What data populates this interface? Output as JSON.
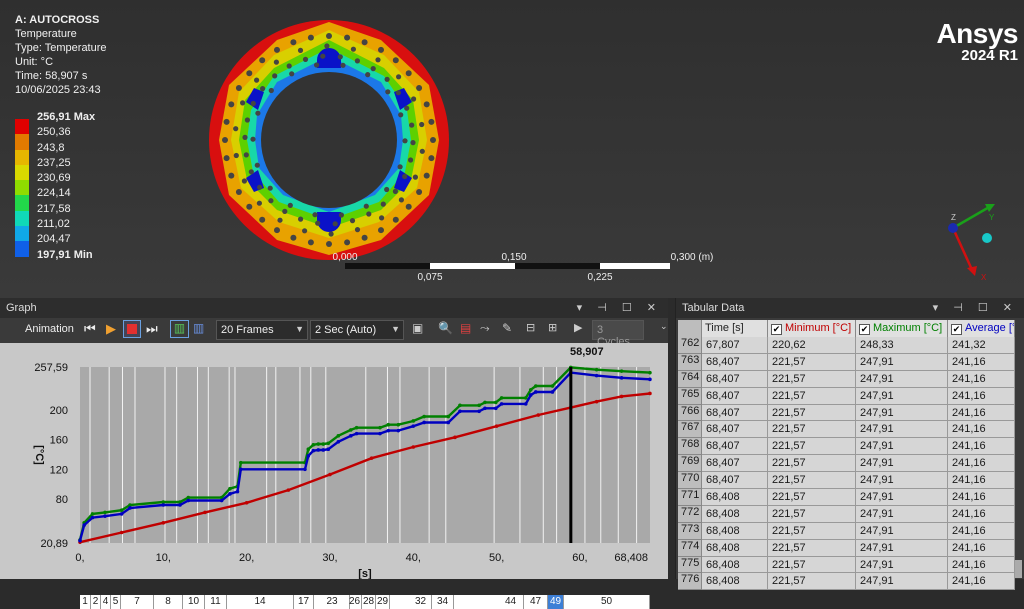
{
  "viewport": {
    "info": {
      "title": "A: AUTOCROSS",
      "result": "Temperature",
      "type": "Type: Temperature",
      "unit": "Unit: °C",
      "time": "Time: 58,907 s",
      "date": "10/06/2025 23:43"
    },
    "legend": [
      {
        "label": "256,91 Max",
        "color": "#e00000",
        "bold": true
      },
      {
        "label": "250,36",
        "color": "#e27a00"
      },
      {
        "label": "243,8",
        "color": "#e6b600"
      },
      {
        "label": "237,25",
        "color": "#d9d900"
      },
      {
        "label": "230,69",
        "color": "#8fdc00"
      },
      {
        "label": "224,14",
        "color": "#22d84a"
      },
      {
        "label": "217,58",
        "color": "#10d8b8"
      },
      {
        "label": "211,02",
        "color": "#10a8e8"
      },
      {
        "label": "204,47",
        "color": "#1060e8"
      },
      {
        "label": "197,91 Min",
        "color": "#0a0ad0",
        "bold": true
      }
    ],
    "logo": {
      "brand": "Ansys",
      "version": "2024 R1"
    },
    "scale": {
      "top": [
        "0,000",
        "0,150",
        "0,300 (m)"
      ],
      "bottom": [
        "0,075",
        "0,225"
      ]
    },
    "triad": {
      "x": "X",
      "y": "Y",
      "z": "Z"
    }
  },
  "graph_panel": {
    "title": "Graph",
    "header_controls": "▾ ⊣ ☐ ✕",
    "animation_label": "Animation",
    "frames_select": "20 Frames",
    "duration_select": "2 Sec (Auto)",
    "cycles_placeholder": "3 Cycles"
  },
  "tabular_panel": {
    "title": "Tabular Data",
    "header_controls": "▾ ⊣ ☐ ✕",
    "columns": [
      "Time [s]",
      "Minimum [°C]",
      "Maximum [°C]",
      "Average [°C]"
    ],
    "rows": [
      [
        "762",
        "67,807",
        "220,62",
        "248,33",
        "241,32"
      ],
      [
        "763",
        "68,407",
        "221,57",
        "247,91",
        "241,16"
      ],
      [
        "764",
        "68,407",
        "221,57",
        "247,91",
        "241,16"
      ],
      [
        "765",
        "68,407",
        "221,57",
        "247,91",
        "241,16"
      ],
      [
        "766",
        "68,407",
        "221,57",
        "247,91",
        "241,16"
      ],
      [
        "767",
        "68,407",
        "221,57",
        "247,91",
        "241,16"
      ],
      [
        "768",
        "68,407",
        "221,57",
        "247,91",
        "241,16"
      ],
      [
        "769",
        "68,407",
        "221,57",
        "247,91",
        "241,16"
      ],
      [
        "770",
        "68,407",
        "221,57",
        "247,91",
        "241,16"
      ],
      [
        "771",
        "68,408",
        "221,57",
        "247,91",
        "241,16"
      ],
      [
        "772",
        "68,408",
        "221,57",
        "247,91",
        "241,16"
      ],
      [
        "773",
        "68,408",
        "221,57",
        "247,91",
        "241,16"
      ],
      [
        "774",
        "68,408",
        "221,57",
        "247,91",
        "241,16"
      ],
      [
        "775",
        "68,408",
        "221,57",
        "247,91",
        "241,16"
      ],
      [
        "776",
        "68,408",
        "221,57",
        "247,91",
        "241,16"
      ]
    ],
    "colors": {
      "minimum": "#c00000",
      "maximum": "#008000",
      "average": "#0000c0"
    }
  },
  "chart_data": {
    "type": "line",
    "xlabel": "[s]",
    "ylabel": "[°C]",
    "xlim": [
      0,
      68.408
    ],
    "ylim": [
      20.89,
      257.59
    ],
    "x_ticks": [
      "0,",
      "10,",
      "20,",
      "30,",
      "40,",
      "50,",
      "60,",
      "68,408"
    ],
    "x_tick_values": [
      0,
      10,
      20,
      30,
      40,
      50,
      60,
      68.408
    ],
    "y_ticks": [
      "20,89",
      "80",
      "120",
      "160",
      "200",
      "257,59"
    ],
    "y_tick_values": [
      20.89,
      80,
      120,
      160,
      200,
      257.59
    ],
    "cursor": {
      "x": 58.907,
      "label": "58,907"
    },
    "series": [
      {
        "name": "Minimum",
        "color": "#c00000",
        "x": [
          0,
          5,
          10,
          15,
          20,
          25,
          30,
          35,
          40,
          45,
          50,
          55,
          58.9,
          62,
          65,
          68.4
        ],
        "values": [
          22,
          35,
          48,
          62,
          75,
          92,
          113,
          135,
          150,
          163,
          178,
          193,
          203,
          211,
          218,
          222
        ]
      },
      {
        "name": "Maximum",
        "color": "#008000",
        "x": [
          0,
          0.5,
          1.5,
          3,
          5,
          6,
          10,
          12,
          13,
          17,
          18,
          18.9,
          19.3,
          27,
          27.4,
          28,
          28.6,
          29.2,
          29.8,
          31,
          32.5,
          33.2,
          36,
          37,
          38.2,
          40,
          41.3,
          44.2,
          45.6,
          47.9,
          48.6,
          49.9,
          50.6,
          53.5,
          54.1,
          54.7,
          56.7,
          58.9,
          62,
          65,
          68.4
        ],
        "values": [
          25,
          48,
          60,
          62,
          65,
          72,
          76,
          76,
          82,
          82,
          94,
          97,
          129,
          129,
          147,
          153,
          154,
          154,
          155,
          165,
          173,
          176,
          176,
          180,
          180,
          185,
          191,
          191,
          206,
          206,
          210,
          210,
          216,
          216,
          227,
          232,
          232,
          257,
          254,
          252,
          250
        ]
      },
      {
        "name": "Average",
        "color": "#0000c0",
        "x": [
          0,
          0.5,
          1.5,
          3,
          5,
          6,
          10,
          12,
          13,
          17,
          18,
          18.9,
          19.3,
          27,
          27.4,
          28,
          28.6,
          29.2,
          29.8,
          31,
          32.5,
          33.2,
          36,
          37,
          38.2,
          40,
          41.3,
          44.2,
          45.6,
          47.9,
          48.6,
          49.9,
          50.6,
          53.5,
          54.1,
          54.7,
          56.7,
          58.9,
          62,
          65,
          68.4
        ],
        "values": [
          24,
          45,
          55,
          57,
          60,
          68,
          72,
          72,
          78,
          78,
          87,
          90,
          120,
          120,
          138,
          145,
          146,
          146,
          147,
          157,
          165,
          168,
          168,
          172,
          172,
          178,
          183,
          183,
          198,
          198,
          202,
          202,
          208,
          208,
          220,
          224,
          224,
          250,
          246,
          243,
          241
        ]
      }
    ]
  },
  "frame_strip": [
    {
      "label": "1"
    },
    {
      "label": "2"
    },
    {
      "label": "4"
    },
    {
      "label": "5"
    },
    {
      "label": "7"
    },
    {
      "label": "8"
    },
    {
      "label": "10"
    },
    {
      "label": "11"
    },
    {
      "label": "14"
    },
    {
      "label": "17"
    },
    {
      "label": "23"
    },
    {
      "label": "26"
    },
    {
      "label": "28"
    },
    {
      "label": "29"
    },
    {
      "label": "32"
    },
    {
      "label": "34"
    },
    {
      "label": "44"
    },
    {
      "label": "47"
    },
    {
      "label": "49",
      "selected": true
    },
    {
      "label": "50"
    }
  ]
}
